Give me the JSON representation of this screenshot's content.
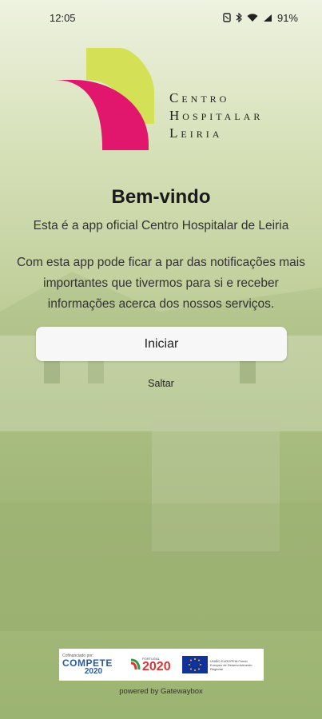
{
  "status_bar": {
    "time": "12:05",
    "battery": "91%"
  },
  "logo": {
    "line1": "Centro",
    "line2": "Hospitalar",
    "line3": "Leiria",
    "colors": {
      "lime": "#d4e157",
      "magenta": "#e91e63"
    }
  },
  "welcome": {
    "title": "Bem-vindo",
    "subtitle": "Esta é a app oficial Centro Hospitalar de Leiria",
    "description": "Com esta app pode ficar a par das notificações mais importantes que tivermos para si e receber informações acerca dos nossos serviços."
  },
  "actions": {
    "start_label": "Iniciar",
    "skip_label": "Saltar"
  },
  "funding": {
    "compete_caption": "Cofinanciado por:",
    "compete_name": "COMPETE",
    "compete_year": "2020",
    "portugal_label": "PORTUGAL",
    "portugal_year": "2020",
    "eu_text": "UNIÃO EUROPEIA Fundo Europeu de Desenvolvimento Regional"
  },
  "footer": {
    "powered_by": "powered by Gatewaybox"
  }
}
